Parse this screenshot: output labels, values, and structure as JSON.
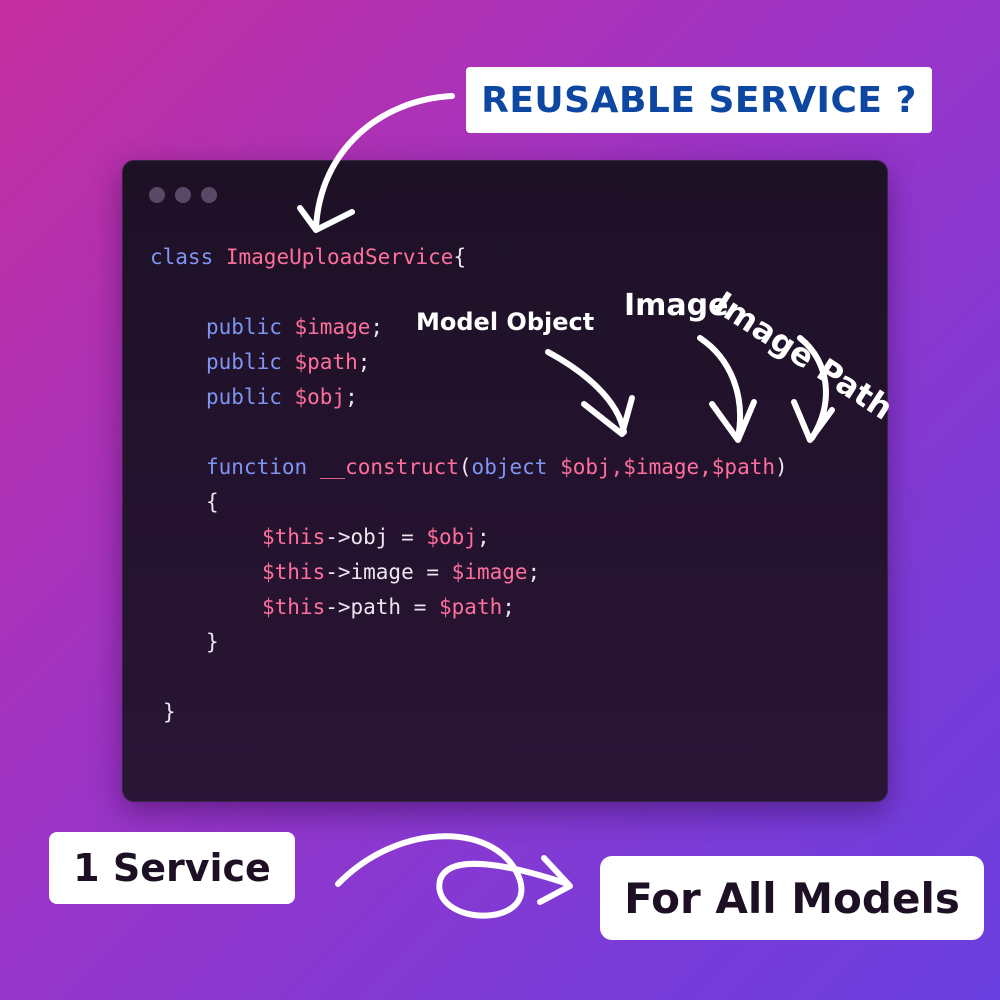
{
  "title_badge": "REUSABLE SERVICE ?",
  "window_dots": [
    "dot",
    "dot",
    "dot"
  ],
  "code": {
    "l1_kw": "class",
    "l1_name": "ImageUploadService",
    "l1_brace": "{",
    "l2_kw": "public",
    "l2_var": "$image",
    "l2_end": ";",
    "l3_kw": "public",
    "l3_var": "$path",
    "l3_end": ";",
    "l4_kw": "public",
    "l4_var": "$obj",
    "l4_end": ";",
    "l5_kw": "function",
    "l5_name": "__construct",
    "l5_open": "(",
    "l5_type": "object",
    "l5_params": "$obj,$image,$path",
    "l5_close": ")",
    "l6": "{",
    "l7_this": "$this",
    "l7_rest": "->obj = ",
    "l7_var": "$obj",
    "l7_end": ";",
    "l8_this": "$this",
    "l8_rest": "->image = ",
    "l8_var": "$image",
    "l8_end": ";",
    "l9_this": "$this",
    "l9_rest": "->path = ",
    "l9_var": "$path",
    "l9_end": ";",
    "l10": "}",
    "l11": "}"
  },
  "annotations": {
    "model_object": "Model Object",
    "image": "Image",
    "image_path": "Image Path"
  },
  "bottom": {
    "left_label": "1 Service",
    "right_label": "For All Models"
  },
  "colors": {
    "keyword": "#7e95f2",
    "identifier": "#ff6f9c",
    "title_text": "#0d47a1"
  }
}
